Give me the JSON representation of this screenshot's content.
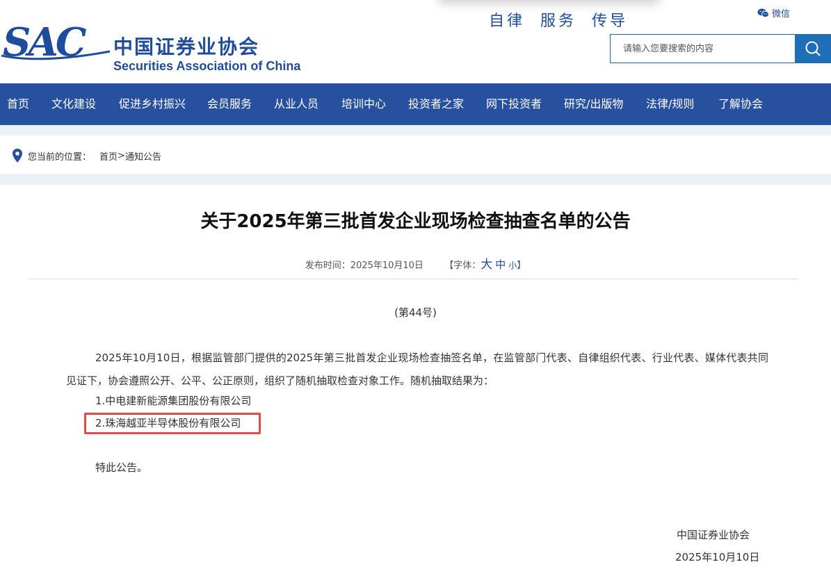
{
  "header": {
    "logo_text": "SAC",
    "logo_cn": "中国证券业协会",
    "logo_en": "Securities Association of China",
    "slogan": [
      "自律",
      "服务",
      "传导"
    ],
    "wechat_label": "微信",
    "search_placeholder": "请输入您要搜索的内容",
    "search_icon": "search-icon"
  },
  "nav": {
    "items": [
      {
        "label": "首页"
      },
      {
        "label": "文化建设"
      },
      {
        "label": "促进乡村振兴"
      },
      {
        "label": "会员服务"
      },
      {
        "label": "从业人员"
      },
      {
        "label": "培训中心"
      },
      {
        "label": "投资者之家"
      },
      {
        "label": "网下投资者"
      },
      {
        "label": "研究/出版物"
      },
      {
        "label": "法律/规则"
      },
      {
        "label": "了解协会"
      }
    ]
  },
  "breadcrumb": {
    "label": "您当前的位置：",
    "home": "首页",
    "separator": ">",
    "current": "通知公告"
  },
  "article": {
    "title": "关于2025年第三批首发企业现场检查抽查名单的公告",
    "publish_label": "发布时间：",
    "publish_date": "2025年10月10日",
    "font_label_open": "【字体：",
    "font_big": "大",
    "font_mid": "中",
    "font_small": "小",
    "font_label_close": "】",
    "doc_number": "(第44号)",
    "paragraph": "2025年10月10日，根据监管部门提供的2025年第三批首发企业现场检查抽签名单，在监管部门代表、自律组织代表、行业代表、媒体代表共同见证下，协会遵照公开、公平、公正原则，组织了随机抽取检查对象工作。随机抽取结果为：",
    "list": [
      "1.中电建新能源集团股份有限公司",
      "2.珠海越亚半导体股份有限公司"
    ],
    "closing": "特此公告。",
    "signature_org": "中国证券业协会",
    "signature_date": "2025年10月10日"
  },
  "colors": {
    "brand_blue": "#27509f",
    "highlight": "#e8474a"
  }
}
